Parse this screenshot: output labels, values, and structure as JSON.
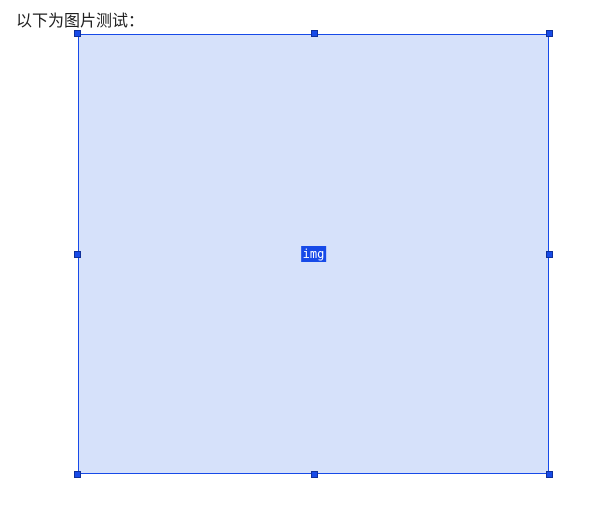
{
  "heading": "以下为图片测试：",
  "inspector": {
    "tag_label": "img"
  }
}
